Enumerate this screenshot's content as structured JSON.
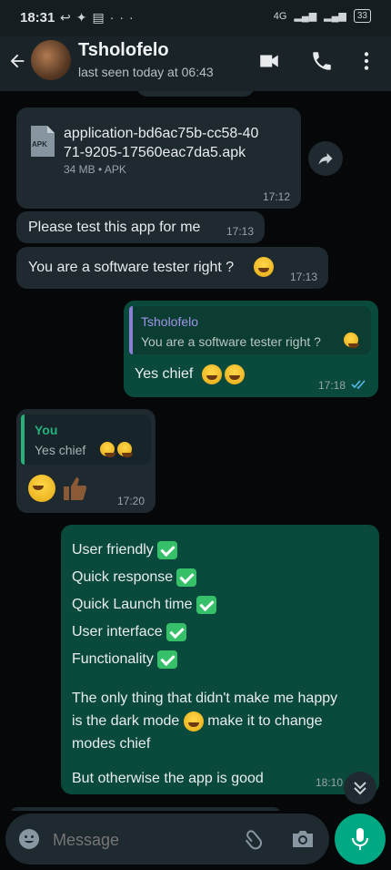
{
  "status_bar": {
    "time": "18:31",
    "battery": "33",
    "network": "4G"
  },
  "header": {
    "name": "Tsholofelo",
    "status": "last seen today at 06:43"
  },
  "messages": {
    "file": {
      "name_line1": "application-bd6ac75b-cc58-40",
      "name_line2": "71-9205-17560eac7da5.apk",
      "meta": "34 MB • APK",
      "badge": "APK",
      "time": "17:12"
    },
    "m1": {
      "text": "Please test this app for me",
      "time": "17:13"
    },
    "m2": {
      "text": "You are a software tester right ?",
      "time": "17:13"
    },
    "m3": {
      "quote_author": "Tsholofelo",
      "quote_text": "You are a software tester right ?",
      "text": "Yes chief",
      "time": "17:18"
    },
    "m4": {
      "quote_author": "You",
      "quote_text": "Yes chief",
      "time": "17:20"
    },
    "m5": {
      "items": [
        "User friendly",
        "Quick response",
        "Quick Launch time",
        "User interface",
        "Functionality"
      ],
      "para1_line1": "The only thing that didn't make me happy",
      "para1_line2a": "is the dark mode",
      "para1_line2b": "make it to change",
      "para1_line3": "modes chief",
      "para2": "But otherwise the app is good",
      "time": "18:10"
    }
  },
  "input": {
    "placeholder": "Message"
  },
  "colors": {
    "accent": "#00a884",
    "outgoing": "#0a4a3c",
    "incoming": "#1e2a30",
    "read_ticks": "#53bdeb"
  }
}
